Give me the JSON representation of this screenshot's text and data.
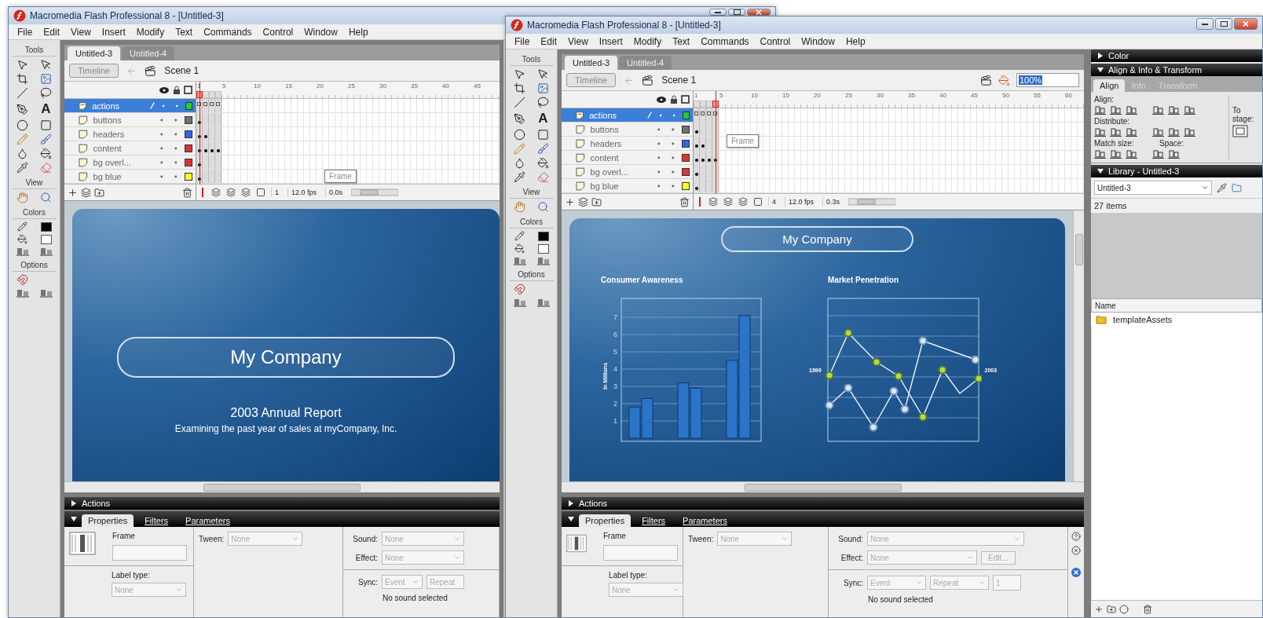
{
  "windows": [
    {
      "title": "Macromedia Flash Professional 8 - [Untitled-3]",
      "menu": [
        "File",
        "Edit",
        "View",
        "Insert",
        "Modify",
        "Text",
        "Commands",
        "Control",
        "Window",
        "Help"
      ],
      "tools": {
        "heading": "Tools",
        "text_tool": "A",
        "sections": [
          "View",
          "Colors",
          "Options"
        ]
      },
      "doc_tabs": [
        {
          "label": "Untitled-3",
          "selected": true
        },
        {
          "label": "Untitled-4",
          "selected": false
        }
      ],
      "timeline_button": "Timeline",
      "scene": "Scene 1",
      "layers": [
        {
          "name": "actions",
          "selected": true,
          "color": "#22cc33",
          "kind": "script",
          "frames": [
            true,
            true,
            true,
            true
          ]
        },
        {
          "name": "buttons",
          "selected": false,
          "color": "#707070",
          "kind": "normal",
          "frames": [
            true,
            false,
            false,
            false
          ]
        },
        {
          "name": "headers",
          "selected": false,
          "color": "#3366dd",
          "kind": "normal",
          "frames": [
            true,
            true,
            false,
            false
          ]
        },
        {
          "name": "content",
          "selected": false,
          "color": "#dd3333",
          "kind": "normal",
          "frames": [
            true,
            true,
            true,
            true
          ]
        },
        {
          "name": "bg overl...",
          "selected": false,
          "color": "#dd3333",
          "kind": "normal",
          "frames": [
            true,
            false,
            false,
            false
          ]
        },
        {
          "name": "bg blue",
          "selected": false,
          "color": "#ffff22",
          "kind": "normal",
          "frames": [
            true,
            false,
            false,
            false
          ]
        }
      ],
      "frame_slots": [
        {
          "selected": true
        },
        {
          "selected": false
        },
        {
          "selected": false
        },
        {
          "selected": false
        }
      ],
      "frame_numbers": [
        "1",
        "5",
        "10",
        "15",
        "20",
        "25",
        "30",
        "35",
        "40",
        "45"
      ],
      "tooltip": "Frame",
      "timeline_footer": {
        "frame": "1",
        "fps": "12.0 fps",
        "time": "0.0s"
      },
      "stage": {
        "kind": "title_slide",
        "title": "My Company",
        "heading": "2003 Annual Report",
        "subtitle": "Examining the past year of sales at myCompany, Inc."
      },
      "actions_bar": {
        "title": "Actions",
        "expanded": false
      },
      "properties": {
        "tabs": [
          {
            "label": "Properties",
            "selected": true
          },
          {
            "label": "Filters",
            "selected": false
          },
          {
            "label": "Parameters",
            "selected": false
          }
        ],
        "frame_label": "Frame",
        "label_type_label": "Label type:",
        "label_type": "None",
        "tween_label": "Tween:",
        "tween": "None",
        "sound_label": "Sound:",
        "sound": "None",
        "effect_label": "Effect:",
        "effect": "None",
        "sync_label": "Sync:",
        "sync": "Event",
        "repeat": "Repeat",
        "status": "No sound selected"
      }
    },
    {
      "title": "Macromedia Flash Professional 8 - [Untitled-3]",
      "menu": [
        "File",
        "Edit",
        "View",
        "Insert",
        "Modify",
        "Text",
        "Commands",
        "Control",
        "Window",
        "Help"
      ],
      "tools": {
        "heading": "Tools",
        "text_tool": "A",
        "sections": [
          "View",
          "Colors",
          "Options"
        ]
      },
      "doc_tabs": [
        {
          "label": "Untitled-3",
          "selected": true
        },
        {
          "label": "Untitled-4",
          "selected": false
        }
      ],
      "timeline_button": "Timeline",
      "scene": "Scene 1",
      "zoom": "100%",
      "layers": [
        {
          "name": "actions",
          "selected": true,
          "color": "#22cc33",
          "kind": "script",
          "frames": [
            true,
            true,
            true,
            true
          ]
        },
        {
          "name": "buttons",
          "selected": false,
          "color": "#707070",
          "kind": "normal",
          "frames": [
            true,
            false,
            false,
            false
          ]
        },
        {
          "name": "headers",
          "selected": false,
          "color": "#3366dd",
          "kind": "normal",
          "frames": [
            true,
            true,
            false,
            false
          ]
        },
        {
          "name": "content",
          "selected": false,
          "color": "#dd3333",
          "kind": "normal",
          "frames": [
            true,
            true,
            true,
            true
          ]
        },
        {
          "name": "bg overl...",
          "selected": false,
          "color": "#dd3333",
          "kind": "normal",
          "frames": [
            true,
            false,
            false,
            false
          ]
        },
        {
          "name": "bg blue",
          "selected": false,
          "color": "#ffff22",
          "kind": "normal",
          "frames": [
            true,
            false,
            false,
            false
          ]
        }
      ],
      "frame_slots": [
        {
          "selected": false
        },
        {
          "selected": false
        },
        {
          "selected": false
        },
        {
          "selected": true
        }
      ],
      "frame_numbers": [
        "1",
        "5",
        "10",
        "15",
        "20",
        "25",
        "30",
        "35",
        "40",
        "45",
        "50",
        "55",
        "60"
      ],
      "tooltip": "Frame",
      "timeline_footer": {
        "frame": "4",
        "fps": "12.0 fps",
        "time": "0.3s"
      },
      "stage": {
        "kind": "charts",
        "title": "My Company",
        "bar_chart": {
          "chart_data": {
            "type": "bar",
            "title": "Consumer Awareness",
            "ylabel": "In Millions",
            "values": [
              1.8,
              2.3,
              3.2,
              2.9,
              4.5,
              7.1
            ],
            "ylim": [
              0,
              8
            ],
            "grid": true,
            "yticks": [
              1,
              2,
              3,
              4,
              5,
              6,
              7
            ]
          }
        },
        "line_chart": {
          "title": "Market Penetration",
          "start_label": "1999",
          "end_label": "2003"
        }
      },
      "actions_bar": {
        "title": "Actions",
        "expanded": false
      },
      "properties": {
        "tabs": [
          {
            "label": "Properties",
            "selected": true
          },
          {
            "label": "Filters",
            "selected": false
          },
          {
            "label": "Parameters",
            "selected": false
          }
        ],
        "frame_label": "Frame",
        "label_type_label": "Label type:",
        "label_type": "None",
        "tween_label": "Tween:",
        "tween": "None",
        "sound_label": "Sound:",
        "sound": "None",
        "effect_label": "Effect:",
        "effect": "None",
        "edit": "Edit...",
        "sync_label": "Sync:",
        "sync": "Event",
        "repeat": "Repeat",
        "repeat_count": "1",
        "status": "No sound selected"
      },
      "side_panels": {
        "color": {
          "title": "Color",
          "expanded": false
        },
        "align": {
          "title": "Align & Info & Transform",
          "expanded": true,
          "tabs": [
            {
              "label": "Align",
              "selected": true
            },
            {
              "label": "Info",
              "selected": false
            },
            {
              "label": "Transform",
              "selected": false
            }
          ],
          "align_label": "Align:",
          "distribute_label": "Distribute:",
          "match_label": "Match size:",
          "space_label": "Space:",
          "stage_label": "To stage:"
        },
        "library": {
          "title": "Library - Untitled-3",
          "expanded": true,
          "document": "Untitled-3",
          "count": "27 items",
          "column": "Name",
          "items": [
            {
              "name": "templateAssets",
              "kind": "folder"
            }
          ]
        }
      }
    }
  ]
}
